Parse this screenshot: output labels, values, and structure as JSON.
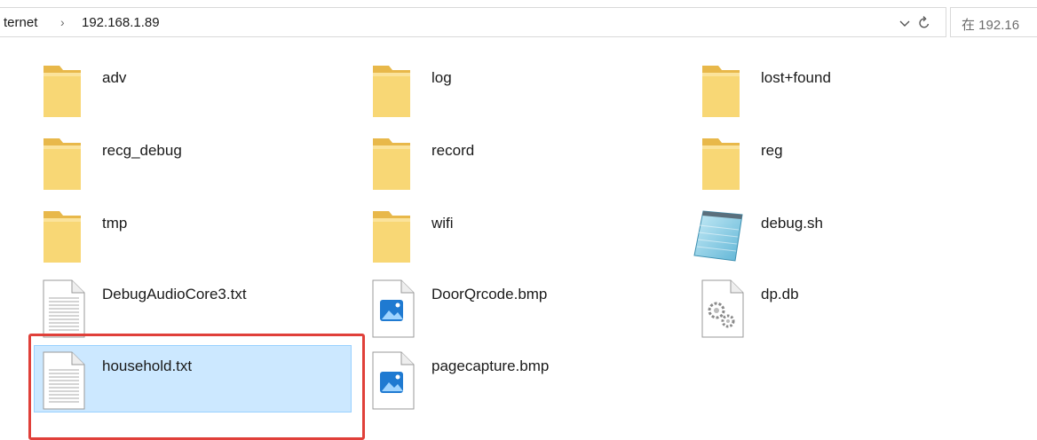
{
  "address_bar": {
    "crumb_parent": "ternet",
    "crumb_separator": "›",
    "crumb_current": "192.168.1.89",
    "dropdown_icon": "chevron-down-icon",
    "refresh_icon": "refresh-icon"
  },
  "search": {
    "placeholder": "在 192.16"
  },
  "files": [
    {
      "name": "adv",
      "type": "folder"
    },
    {
      "name": "log",
      "type": "folder"
    },
    {
      "name": "lost+found",
      "type": "folder"
    },
    {
      "name": "recg_debug",
      "type": "folder"
    },
    {
      "name": "record",
      "type": "folder"
    },
    {
      "name": "reg",
      "type": "folder"
    },
    {
      "name": "tmp",
      "type": "folder"
    },
    {
      "name": "wifi",
      "type": "folder"
    },
    {
      "name": "debug.sh",
      "type": "notepad-file"
    },
    {
      "name": "DebugAudioCore3.txt",
      "type": "text-file"
    },
    {
      "name": "DoorQrcode.bmp",
      "type": "image-file"
    },
    {
      "name": "dp.db",
      "type": "system-file"
    },
    {
      "name": "household.txt",
      "type": "text-file",
      "selected": true
    },
    {
      "name": "pagecapture.bmp",
      "type": "image-file"
    }
  ],
  "colors": {
    "selection_bg": "#cce8ff",
    "selection_border": "#99d1ff",
    "highlight_border": "#e0403a",
    "folder_yellow": "#f8d775"
  }
}
